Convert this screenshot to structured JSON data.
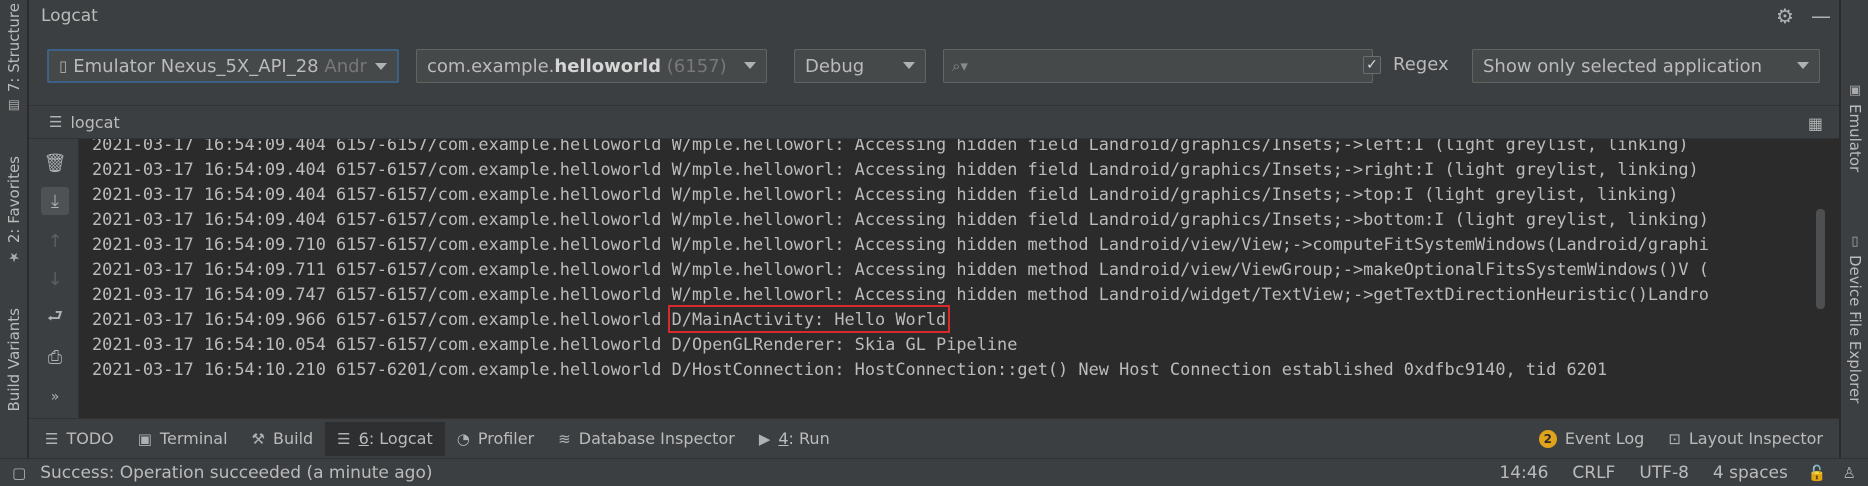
{
  "left_stripe": {
    "structure": "7: Structure",
    "favorites": "2: Favorites",
    "build_variants": "Build Variants"
  },
  "right_stripe": {
    "emulator": "Emulator",
    "device_file_explorer": "Device File Explorer"
  },
  "window": {
    "title": "Logcat"
  },
  "toolbar": {
    "device": {
      "name": "Emulator Nexus_5X_API_28",
      "suffix": "Andr"
    },
    "process": {
      "prefix": "com.example.",
      "bold": "helloworld",
      "pid": "(6157)"
    },
    "level": "Debug",
    "search": {
      "value": "",
      "placeholder": ""
    },
    "regex": {
      "label": "Regex",
      "checked": "✓"
    },
    "filter": "Show only selected application"
  },
  "tab": {
    "label": "logcat"
  },
  "log": {
    "lines": [
      "2021-03-17 16:54:09.404 6157-6157/com.example.helloworld W/mple.helloworl: Accessing hidden field Landroid/graphics/Insets;->left:I (light greylist, linking)",
      "2021-03-17 16:54:09.404 6157-6157/com.example.helloworld W/mple.helloworl: Accessing hidden field Landroid/graphics/Insets;->right:I (light greylist, linking)",
      "2021-03-17 16:54:09.404 6157-6157/com.example.helloworld W/mple.helloworl: Accessing hidden field Landroid/graphics/Insets;->top:I (light greylist, linking)",
      "2021-03-17 16:54:09.404 6157-6157/com.example.helloworld W/mple.helloworl: Accessing hidden field Landroid/graphics/Insets;->bottom:I (light greylist, linking)",
      "2021-03-17 16:54:09.710 6157-6157/com.example.helloworld W/mple.helloworl: Accessing hidden method Landroid/view/View;->computeFitSystemWindows(Landroid/graphi",
      "2021-03-17 16:54:09.711 6157-6157/com.example.helloworld W/mple.helloworl: Accessing hidden method Landroid/view/ViewGroup;->makeOptionalFitsSystemWindows()V (",
      "2021-03-17 16:54:09.747 6157-6157/com.example.helloworld W/mple.helloworl: Accessing hidden method Landroid/widget/TextView;->getTextDirectionHeuristic()Landro"
    ],
    "highlight_prefix": "2021-03-17 16:54:09.966 6157-6157/com.example.helloworld ",
    "highlight_text": "D/MainActivity: Hello World",
    "after": [
      "2021-03-17 16:54:10.054 6157-6157/com.example.helloworld D/OpenGLRenderer: Skia GL Pipeline",
      "2021-03-17 16:54:10.210 6157-6201/com.example.helloworld D/HostConnection: HostConnection::get() New Host Connection established 0xdfbc9140, tid 6201"
    ]
  },
  "tool_windows": {
    "todo": "TODO",
    "terminal": "Terminal",
    "build": "Build",
    "logcat_num": "6",
    "logcat_label": ": Logcat",
    "profiler": "Profiler",
    "db_inspector": "Database Inspector",
    "run_num": "4",
    "run_label": ": Run",
    "event_log_badge": "2",
    "event_log": "Event Log",
    "layout_inspector": "Layout Inspector"
  },
  "status": {
    "message": "Success: Operation succeeded (a minute ago)",
    "time": "14:46",
    "line_sep": "CRLF",
    "encoding": "UTF-8",
    "indent": "4 spaces"
  }
}
